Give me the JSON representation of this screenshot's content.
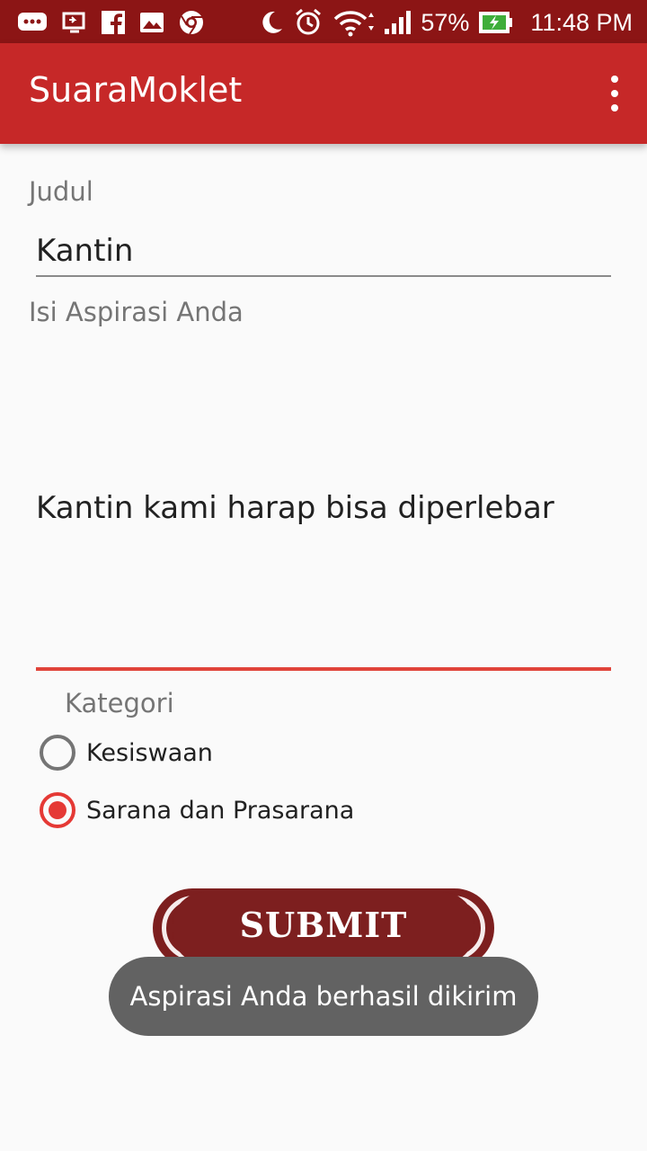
{
  "status_bar": {
    "battery": "57%",
    "time": "11:48 PM",
    "icons": [
      "message-icon",
      "cast-icon",
      "facebook-icon",
      "gallery-icon",
      "chrome-icon",
      "moon-icon",
      "alarm-icon",
      "wifi-icon",
      "signal-icon",
      "battery-charging-icon"
    ]
  },
  "app_bar": {
    "title": "SuaraMoklet",
    "menu_icon": "more-vert-icon"
  },
  "form": {
    "title_label": "Judul",
    "title_value": "Kantin",
    "content_label": "Isi Aspirasi Anda",
    "content_value": "Kantin kami harap bisa diperlebar",
    "category_label": "Kategori",
    "categories": [
      {
        "label": "Kesiswaan",
        "checked": false
      },
      {
        "label": "Sarana dan Prasarana",
        "checked": true
      }
    ],
    "submit_label": "SUBMIT"
  },
  "toast": {
    "message": "Aspirasi Anda berhasil dikirim"
  },
  "colors": {
    "status_bar": "#8c1515",
    "app_bar": "#c62828",
    "accent": "#e53935",
    "submit": "#7d1f1f",
    "toast": "#626262"
  }
}
